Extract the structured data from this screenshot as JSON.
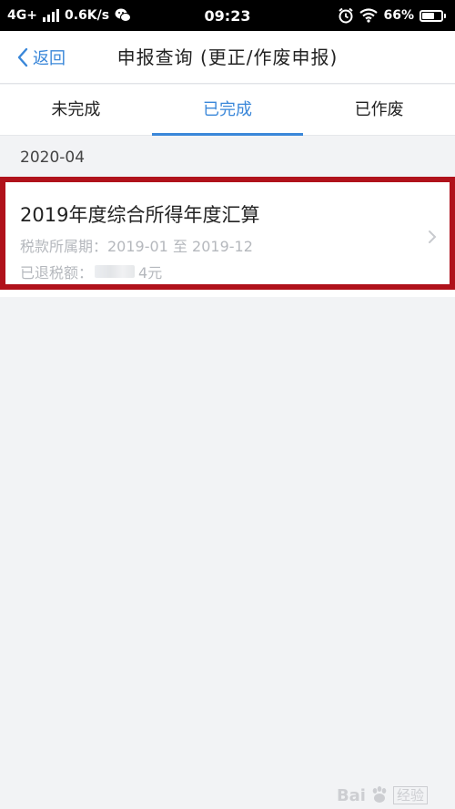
{
  "status_bar": {
    "network": "4G+",
    "speed": "0.6K/s",
    "time": "09:23",
    "battery": "66%"
  },
  "nav": {
    "back_label": "返回",
    "title": "申报查询 (更正/作废申报)"
  },
  "tabs": [
    {
      "label": "未完成",
      "active": false
    },
    {
      "label": "已完成",
      "active": true
    },
    {
      "label": "已作废",
      "active": false
    }
  ],
  "section": {
    "date": "2020-04"
  },
  "record": {
    "title": "2019年度综合所得年度汇算",
    "period": "税款所属期：2019-01 至 2019-12",
    "refund_label": "已退税额：",
    "refund_value_visible": "4元"
  },
  "watermark": {
    "brand": "Bai",
    "sub": "经验"
  },
  "colors": {
    "accent": "#3a87d9",
    "highlight_border": "#b0121b",
    "muted_text": "#b5b8bd",
    "background": "#f2f3f5"
  },
  "icons": [
    "signal-bars-icon",
    "wechat-icon",
    "alarm-icon",
    "wifi-icon",
    "battery-icon",
    "back-chevron-icon",
    "chevron-right-icon",
    "baidu-paw-icon"
  ]
}
